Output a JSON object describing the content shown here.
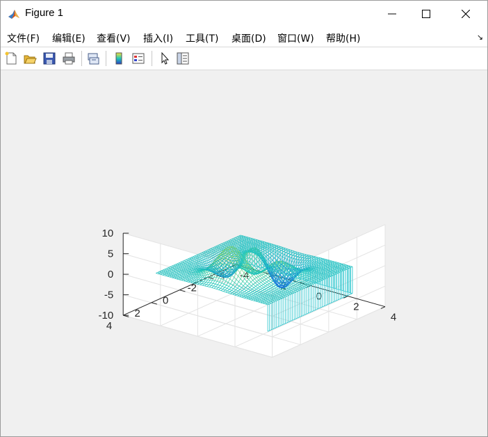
{
  "window": {
    "title": "Figure 1",
    "controls": [
      "minimize",
      "maximize",
      "close"
    ]
  },
  "menu": {
    "items": [
      "文件(F)",
      "编辑(E)",
      "查看(V)",
      "插入(I)",
      "工具(T)",
      "桌面(D)",
      "窗口(W)",
      "帮助(H)"
    ],
    "more": "↘"
  },
  "toolbar": {
    "buttons": [
      "new-figure-icon",
      "open-file-icon",
      "save-icon",
      "print-icon",
      "link-plot-icon",
      "insert-colorbar-icon",
      "insert-legend-icon",
      "edit-plot-arrow-icon",
      "property-inspector-icon"
    ]
  },
  "colors": {
    "surface_low": "#1a6fe0",
    "surface_mid": "#1fc8b8",
    "surface_high": "#f5e23a",
    "skirt": "#30c7cf"
  },
  "chart_data": {
    "type": "mesh",
    "function": "peaks",
    "mesh_with_curtain": true,
    "x_range": [
      -3,
      3
    ],
    "y_range": [
      -3,
      3
    ],
    "xlim": [
      -4,
      4
    ],
    "ylim": [
      -4,
      4
    ],
    "zlim": [
      -10,
      10
    ],
    "z_ticks": [
      "10",
      "5",
      "0",
      "-5",
      "-10"
    ],
    "x_ticks": [
      "-4",
      "-2",
      "0",
      "2",
      "4"
    ],
    "y_ticks": [
      "4",
      "2",
      "0",
      "-2",
      "-4"
    ],
    "colormap": "parula",
    "grid": true,
    "view": [
      -37.5,
      30
    ]
  }
}
